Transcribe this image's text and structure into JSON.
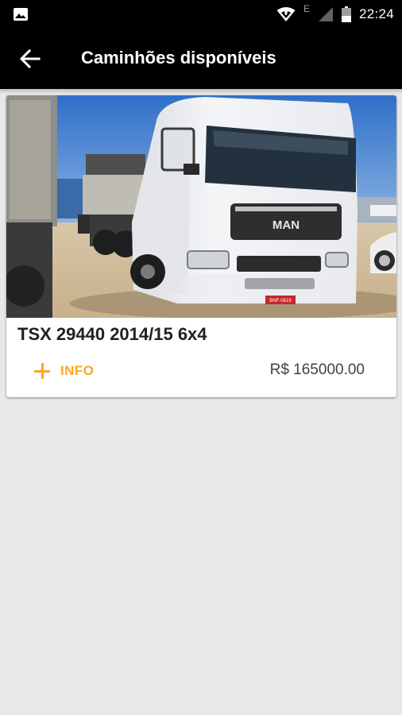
{
  "status_bar": {
    "time": "22:24",
    "network_label": "E",
    "icons": [
      "image-icon",
      "wifi-icon",
      "signal-icon",
      "battery-icon"
    ]
  },
  "app_bar": {
    "title": "Caminhões disponíveis",
    "back_icon": "arrow-back-icon"
  },
  "listings": [
    {
      "image": "white MAN truck cab",
      "plate": "BNF-0619",
      "brand_badge": "MAN",
      "title": "TSX 29440 2014/15 6x4",
      "action_label": "INFO",
      "action_icon": "plus-icon",
      "price": "R$ 165000.00"
    }
  ],
  "colors": {
    "background": "#e8e8e8",
    "app_bar": "#000000",
    "accent": "#f9a825",
    "card": "#ffffff"
  }
}
